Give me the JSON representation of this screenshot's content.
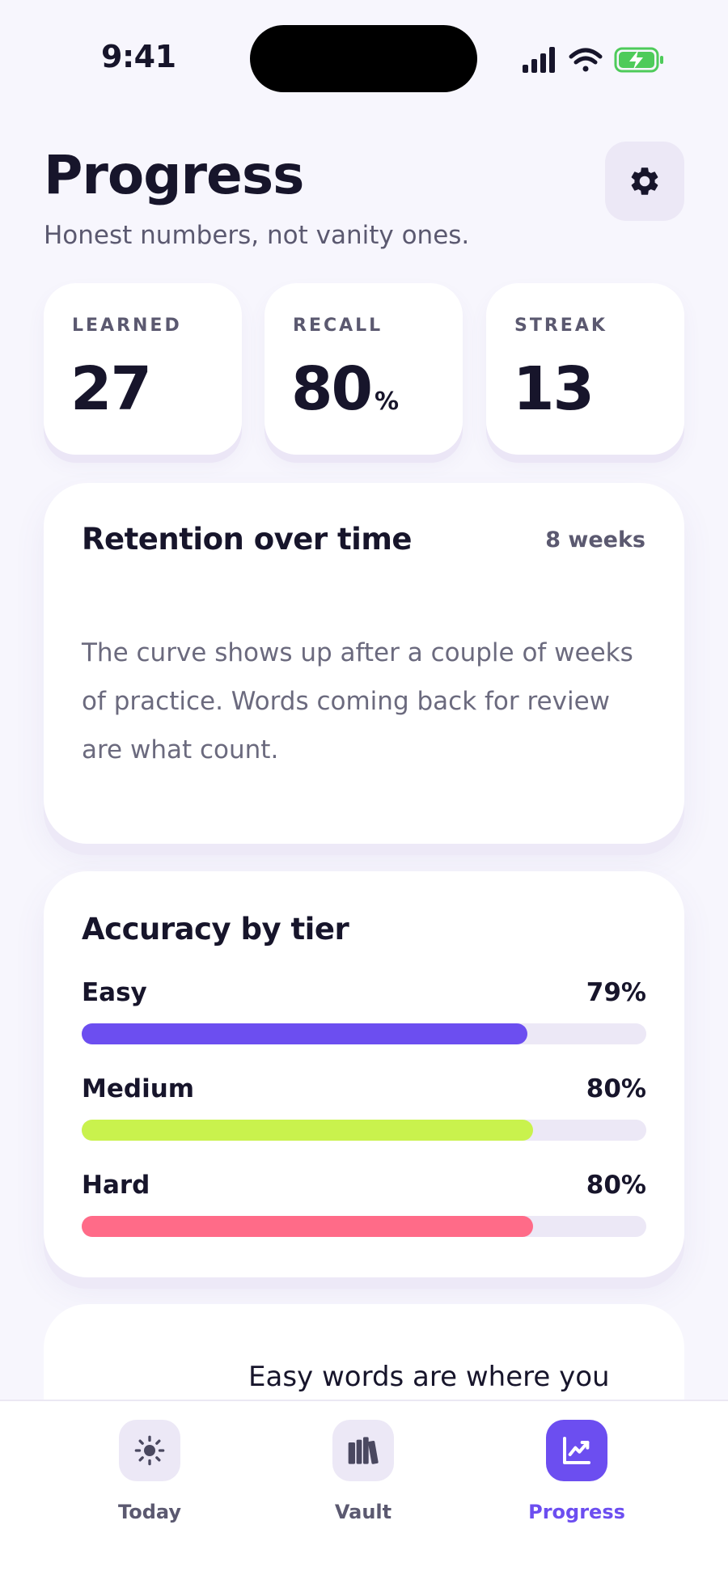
{
  "status_bar": {
    "time": "9:41"
  },
  "header": {
    "title": "Progress",
    "subtitle": "Honest numbers, not vanity ones.",
    "settings_icon": "gear-icon"
  },
  "stats": [
    {
      "label": "LEARNED",
      "value": "27",
      "unit": ""
    },
    {
      "label": "RECALL",
      "value": "80",
      "unit": "%"
    },
    {
      "label": "STREAK",
      "value": "13",
      "unit": ""
    }
  ],
  "retention": {
    "title": "Retention over time",
    "range": "8 weeks",
    "body": "The curve shows up after a couple of weeks of practice. Words coming back for review are what count."
  },
  "accuracy": {
    "title": "Accuracy by tier",
    "tiers": [
      {
        "label": "Easy",
        "percent_text": "79%",
        "value": 79,
        "color": "#6c4ef0"
      },
      {
        "label": "Medium",
        "percent_text": "80%",
        "value": 80,
        "color": "#c9f24d"
      },
      {
        "label": "Hard",
        "percent_text": "80%",
        "value": 80,
        "color": "#ff6b88"
      }
    ]
  },
  "teaser": {
    "text": "Easy words are where you"
  },
  "nav": {
    "items": [
      {
        "label": "Today",
        "icon": "sun-icon",
        "active": false
      },
      {
        "label": "Vault",
        "icon": "books-icon",
        "active": false
      },
      {
        "label": "Progress",
        "icon": "chart-icon",
        "active": true
      }
    ]
  },
  "colors": {
    "accent": "#6c4ef0",
    "background": "#f7f6fd",
    "text": "#17152b",
    "muted": "#5b5970"
  }
}
